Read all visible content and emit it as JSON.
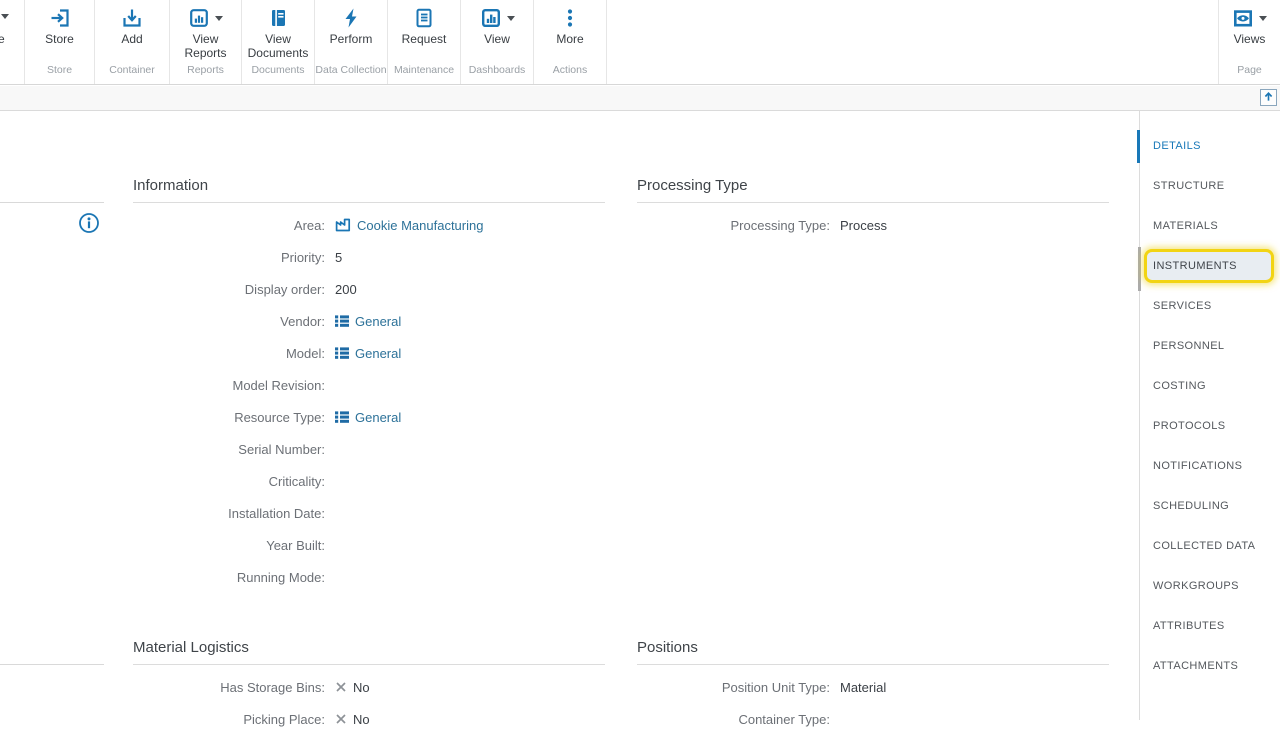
{
  "colors": {
    "toolbar_icon_blue": "#1b76b4",
    "link_blue": "#2d7299",
    "active_tab_blue": "#1878b8",
    "highlight_yellow": "#f2d413",
    "highlight_fill": "#e8edf2"
  },
  "toolbar": {
    "cut_button": {
      "label_fragment": "e",
      "has_caret": true
    },
    "groups": [
      {
        "group_label": "Store",
        "buttons": [
          {
            "label": "Store",
            "icon": "store-icon",
            "has_caret": false
          }
        ]
      },
      {
        "group_label": "Container",
        "buttons": [
          {
            "label": "Add",
            "icon": "add-container-icon",
            "has_caret": false
          }
        ]
      },
      {
        "group_label": "Reports",
        "buttons": [
          {
            "label": "View Reports",
            "icon": "view-reports-icon",
            "has_caret": true
          }
        ]
      },
      {
        "group_label": "Documents",
        "buttons": [
          {
            "label": "View Documents",
            "icon": "view-documents-icon",
            "has_caret": false
          }
        ]
      },
      {
        "group_label": "Data Collection",
        "buttons": [
          {
            "label": "Perform",
            "icon": "lightning-icon",
            "has_caret": false
          }
        ]
      },
      {
        "group_label": "Maintenance",
        "buttons": [
          {
            "label": "Request",
            "icon": "maintenance-request-icon",
            "has_caret": false
          }
        ]
      },
      {
        "group_label": "Dashboards",
        "buttons": [
          {
            "label": "View",
            "icon": "dashboards-icon",
            "has_caret": true
          }
        ]
      },
      {
        "group_label": "Actions",
        "buttons": [
          {
            "label": "More",
            "icon": "more-ellipsis-icon",
            "has_caret": false
          }
        ]
      },
      {
        "group_label": "Page",
        "buttons": [
          {
            "label": "Views",
            "icon": "views-eye-icon",
            "has_caret": true
          }
        ]
      }
    ]
  },
  "sections": {
    "information": {
      "title": "Information",
      "fields": [
        {
          "label": "Area:",
          "value": "Cookie Manufacturing",
          "icon": "factory-icon",
          "link": true
        },
        {
          "label": "Priority:",
          "value": "5"
        },
        {
          "label": "Display order:",
          "value": "200"
        },
        {
          "label": "Vendor:",
          "value": "General",
          "icon": "list-icon",
          "link": true
        },
        {
          "label": "Model:",
          "value": "General",
          "icon": "list-icon",
          "link": true
        },
        {
          "label": "Model Revision:",
          "value": ""
        },
        {
          "label": "Resource Type:",
          "value": "General",
          "icon": "list-icon",
          "link": true
        },
        {
          "label": "Serial Number:",
          "value": ""
        },
        {
          "label": "Criticality:",
          "value": ""
        },
        {
          "label": "Installation Date:",
          "value": ""
        },
        {
          "label": "Year Built:",
          "value": ""
        },
        {
          "label": "Running Mode:",
          "value": ""
        }
      ]
    },
    "processing_type": {
      "title": "Processing Type",
      "fields": [
        {
          "label": "Processing Type:",
          "value": "Process"
        }
      ]
    },
    "material_logistics": {
      "title": "Material Logistics",
      "fields": [
        {
          "label": "Has Storage Bins:",
          "value": "No",
          "icon": "x-icon"
        },
        {
          "label": "Picking Place:",
          "value": "No",
          "icon": "x-icon"
        }
      ]
    },
    "positions": {
      "title": "Positions",
      "fields": [
        {
          "label": "Position Unit Type:",
          "value": "Material"
        },
        {
          "label": "Container Type:",
          "value": ""
        }
      ]
    }
  },
  "sidebar": {
    "items": [
      {
        "label": "DETAILS",
        "active": true
      },
      {
        "label": "STRUCTURE"
      },
      {
        "label": "MATERIALS"
      },
      {
        "label": "INSTRUMENTS",
        "highlighted": true
      },
      {
        "label": "SERVICES"
      },
      {
        "label": "PERSONNEL"
      },
      {
        "label": "COSTING"
      },
      {
        "label": "PROTOCOLS"
      },
      {
        "label": "NOTIFICATIONS"
      },
      {
        "label": "SCHEDULING"
      },
      {
        "label": "COLLECTED DATA"
      },
      {
        "label": "WORKGROUPS"
      },
      {
        "label": "ATTRIBUTES"
      },
      {
        "label": "ATTACHMENTS"
      }
    ]
  }
}
